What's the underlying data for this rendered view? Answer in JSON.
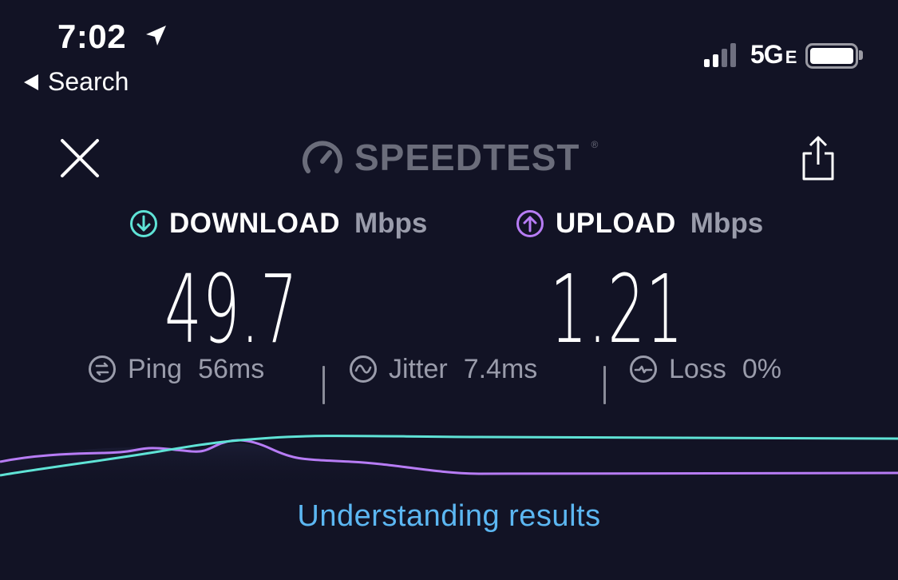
{
  "status_bar": {
    "time": "7:02",
    "back_label": "Search",
    "network": "5G",
    "network_suffix": "E"
  },
  "header": {
    "brand": "SPEEDTEST",
    "trademark": "®"
  },
  "download": {
    "label": "DOWNLOAD",
    "unit": "Mbps",
    "value": "49.7",
    "color": "#5fe3d6"
  },
  "upload": {
    "label": "UPLOAD",
    "unit": "Mbps",
    "value": "1.21",
    "color": "#b77cf5"
  },
  "stats": {
    "ping_label": "Ping",
    "ping_value": "56",
    "ping_unit": "ms",
    "jitter_label": "Jitter",
    "jitter_value": "7.4",
    "jitter_unit": "ms",
    "loss_label": "Loss",
    "loss_value": "0",
    "loss_unit": "%"
  },
  "footer": {
    "link": "Understanding results"
  }
}
